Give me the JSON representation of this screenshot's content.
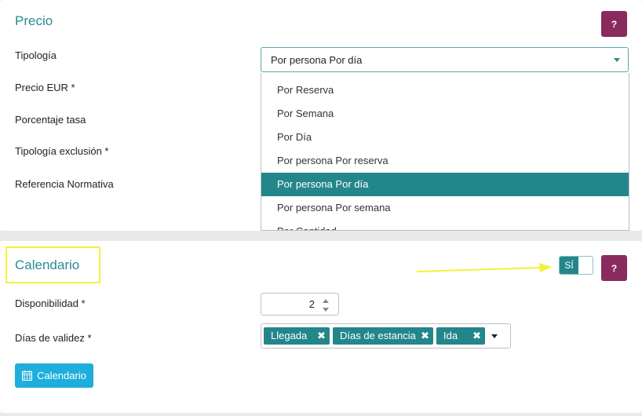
{
  "precio": {
    "title": "Precio",
    "help_label": "?",
    "labels": {
      "tipologia": "Tipología",
      "precio_eur": "Precio EUR  *",
      "porcentaje_tasa": "Porcentaje tasa",
      "tipologia_exclusion": "Tipología exclusión  *",
      "referencia_normativa": "Referencia Normativa"
    },
    "tipologia_select": {
      "value": "Por persona Por día",
      "options": [
        "Por Reserva",
        "Por Semana",
        "Por Día",
        "Por persona Por reserva",
        "Por persona Por día",
        "Por persona Por semana",
        "Por Cantidad"
      ],
      "selected_index": 4
    }
  },
  "calendario": {
    "title": "Calendario",
    "help_label": "?",
    "toggle_label": "SÍ",
    "labels": {
      "disponibilidad": "Disponibilidad  *",
      "dias_validez": "Días de validez  *"
    },
    "disponibilidad_value": "2",
    "dias_tags": [
      "Llegada",
      "Días de estancia",
      "Ida"
    ],
    "tag_remove_glyph": "✖",
    "button_label": "Calendario"
  },
  "colors": {
    "accent": "#23868b",
    "help_button": "#8b2a5e",
    "primary_button": "#1eaedc",
    "annotation": "#f2f23a"
  }
}
